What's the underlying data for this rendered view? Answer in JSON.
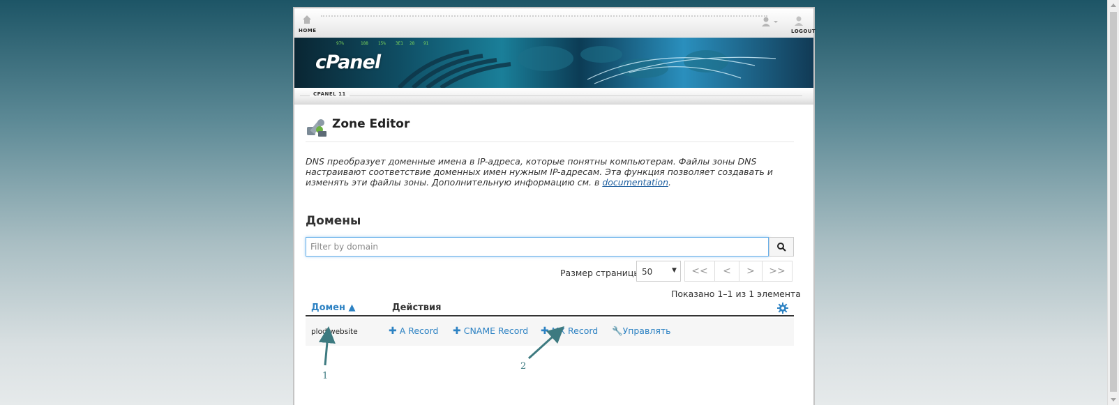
{
  "topbar": {
    "home_label": "HOME",
    "logout_label": "LOGOUT"
  },
  "banner": {
    "logo_text": "cPanel"
  },
  "subbar": {
    "version": "CPANEL 11"
  },
  "header": {
    "title": "Zone Editor"
  },
  "description": {
    "text": "DNS преобразует доменные имена в IP-адреса, которые понятны компьютерам. Файлы зоны DNS настраивают соответствие доменных имен нужным IP-адресам. Эта функция позволяет создавать и изменять эти файлы зоны. Дополнительную информацию см. в ",
    "link_text": "documentation",
    "suffix": "."
  },
  "domains": {
    "section_title": "Домены",
    "search_placeholder": "Filter by domain",
    "page_size_label": "Размер страницы",
    "page_size_value": "50",
    "pager": [
      "<<",
      "<",
      ">",
      ">>"
    ],
    "shown_text": "Показано 1–1 из 1 элемента",
    "columns": {
      "domain": "Домен ▲",
      "actions": "Действия"
    },
    "rows": [
      {
        "domain": "plod.website",
        "actions": [
          "A Record",
          "CNAME Record",
          "MX Record",
          "Управлять"
        ]
      }
    ]
  },
  "annotations": {
    "label_1": "1",
    "label_2": "2"
  },
  "colors": {
    "accent": "#2d82c3",
    "annotation": "#3d7a80"
  }
}
